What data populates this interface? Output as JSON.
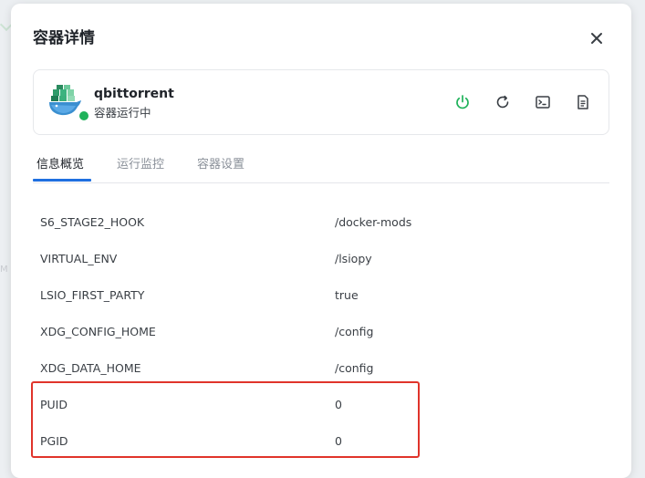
{
  "modal": {
    "title": "容器详情"
  },
  "container": {
    "name": "qbittorrent",
    "status": "容器运行中",
    "status_color": "#1fb25a"
  },
  "actions": [
    {
      "icon": "power-icon",
      "color": "#1fb25a"
    },
    {
      "icon": "restart-icon",
      "color": "#3a3f45"
    },
    {
      "icon": "terminal-icon",
      "color": "#3a3f45"
    },
    {
      "icon": "log-file-icon",
      "color": "#3a3f45"
    }
  ],
  "tabs": [
    {
      "label": "信息概览",
      "active": true
    },
    {
      "label": "运行监控",
      "active": false
    },
    {
      "label": "容器设置",
      "active": false
    }
  ],
  "env": [
    {
      "key": "S6_STAGE2_HOOK",
      "value": "/docker-mods"
    },
    {
      "key": "VIRTUAL_ENV",
      "value": "/lsiopy"
    },
    {
      "key": "LSIO_FIRST_PARTY",
      "value": "true"
    },
    {
      "key": "XDG_CONFIG_HOME",
      "value": "/config"
    },
    {
      "key": "XDG_DATA_HOME",
      "value": "/config"
    },
    {
      "key": "PUID",
      "value": "0"
    },
    {
      "key": "PGID",
      "value": "0"
    }
  ],
  "colors": {
    "accent": "#1f6fe0",
    "highlight": "#e0342b"
  }
}
